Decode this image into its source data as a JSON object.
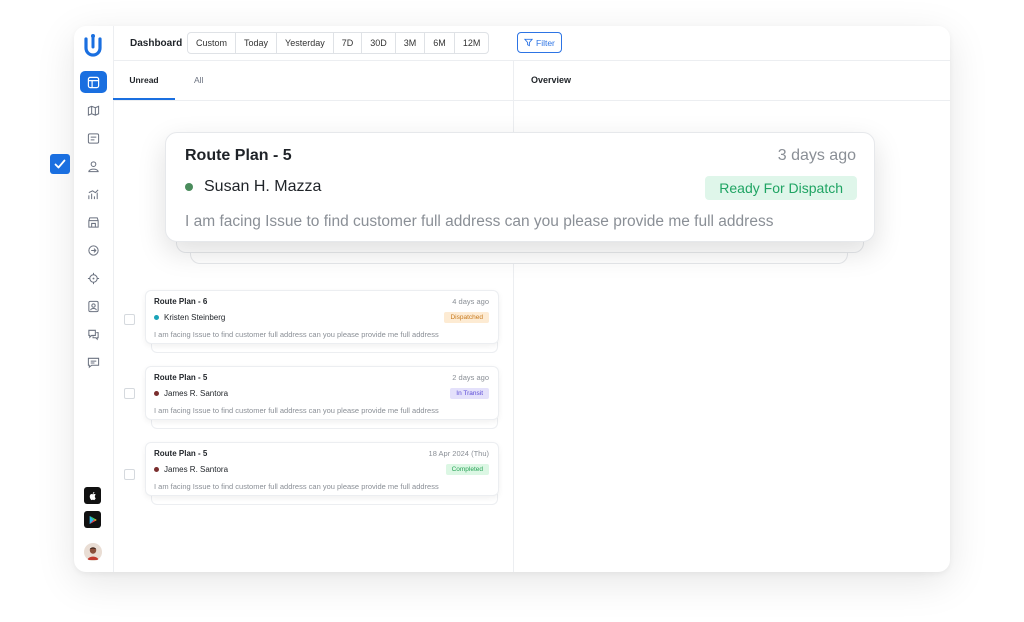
{
  "header": {
    "title": "Dashboard",
    "ranges": [
      "Custom",
      "Today",
      "Yesterday",
      "7D",
      "30D",
      "3M",
      "6M",
      "12M"
    ],
    "filter_label": "Filter"
  },
  "sidebar": {
    "items": [
      {
        "icon": "layout-icon",
        "active": true
      },
      {
        "icon": "map-icon",
        "active": false
      },
      {
        "icon": "list-icon",
        "active": false
      },
      {
        "icon": "users-icon",
        "active": false
      },
      {
        "icon": "chart-icon",
        "active": false
      },
      {
        "icon": "store-icon",
        "active": false
      },
      {
        "icon": "route-icon",
        "active": false
      },
      {
        "icon": "target-icon",
        "active": false
      },
      {
        "icon": "contact-card-icon",
        "active": false
      },
      {
        "icon": "chat-question-icon",
        "active": false
      },
      {
        "icon": "message-icon",
        "active": false
      }
    ],
    "apps": [
      "apple-icon",
      "google-play-icon"
    ]
  },
  "tabs": {
    "unread": "Unread",
    "all": "All"
  },
  "overview": {
    "title": "Overview"
  },
  "featured": {
    "title": "Route Plan - 5",
    "time": "3 days ago",
    "name": "Susan H. Mazza",
    "status": "Ready For Dispatch",
    "message": "I am facing Issue to find customer full address can you please provide me full address",
    "dot_color": "#4a8c5c"
  },
  "notifications": [
    {
      "title": "Route Plan - 6",
      "time": "4 days ago",
      "name": "Kristen Steinberg",
      "status": "Dispatched",
      "message": "I am facing Issue to find customer full address can you please provide me full address",
      "dot_color": "#1aa3b8",
      "badge_bg": "#fdebd3",
      "badge_fg": "#c77a1e"
    },
    {
      "title": "Route Plan - 5",
      "time": "2 days ago",
      "name": "James R. Santora",
      "status": "In Transit",
      "message": "I am facing Issue to find customer full address can you please provide me full address",
      "dot_color": "#7a2e2e",
      "badge_bg": "#e4e1fb",
      "badge_fg": "#5b4bd6"
    },
    {
      "title": "Route Plan - 5",
      "time": "18 Apr 2024 (Thu)",
      "name": "James R. Santora",
      "status": "Completed",
      "message": "I am facing Issue to find customer full address can you please provide me full address",
      "dot_color": "#7a2e2e",
      "badge_bg": "#dcf7e4",
      "badge_fg": "#27a356"
    }
  ]
}
